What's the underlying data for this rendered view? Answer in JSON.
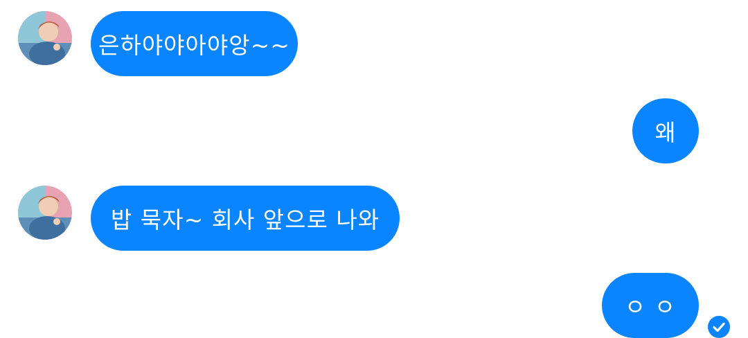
{
  "messages": [
    {
      "side": "incoming",
      "text": "은하야야아야앙~~"
    },
    {
      "side": "outgoing",
      "text": "왜"
    },
    {
      "side": "incoming",
      "text": "밥 묵자~ 회사 앞으로 나와"
    },
    {
      "side": "outgoing",
      "text": "ㅇ ㅇ"
    }
  ],
  "icons": {
    "avatar": "contact-avatar-photo",
    "read_receipt": "check-circle-icon"
  },
  "colors": {
    "bubble": "#0a84ff",
    "bubble_text": "#ffffff",
    "background": "#ffffff"
  }
}
